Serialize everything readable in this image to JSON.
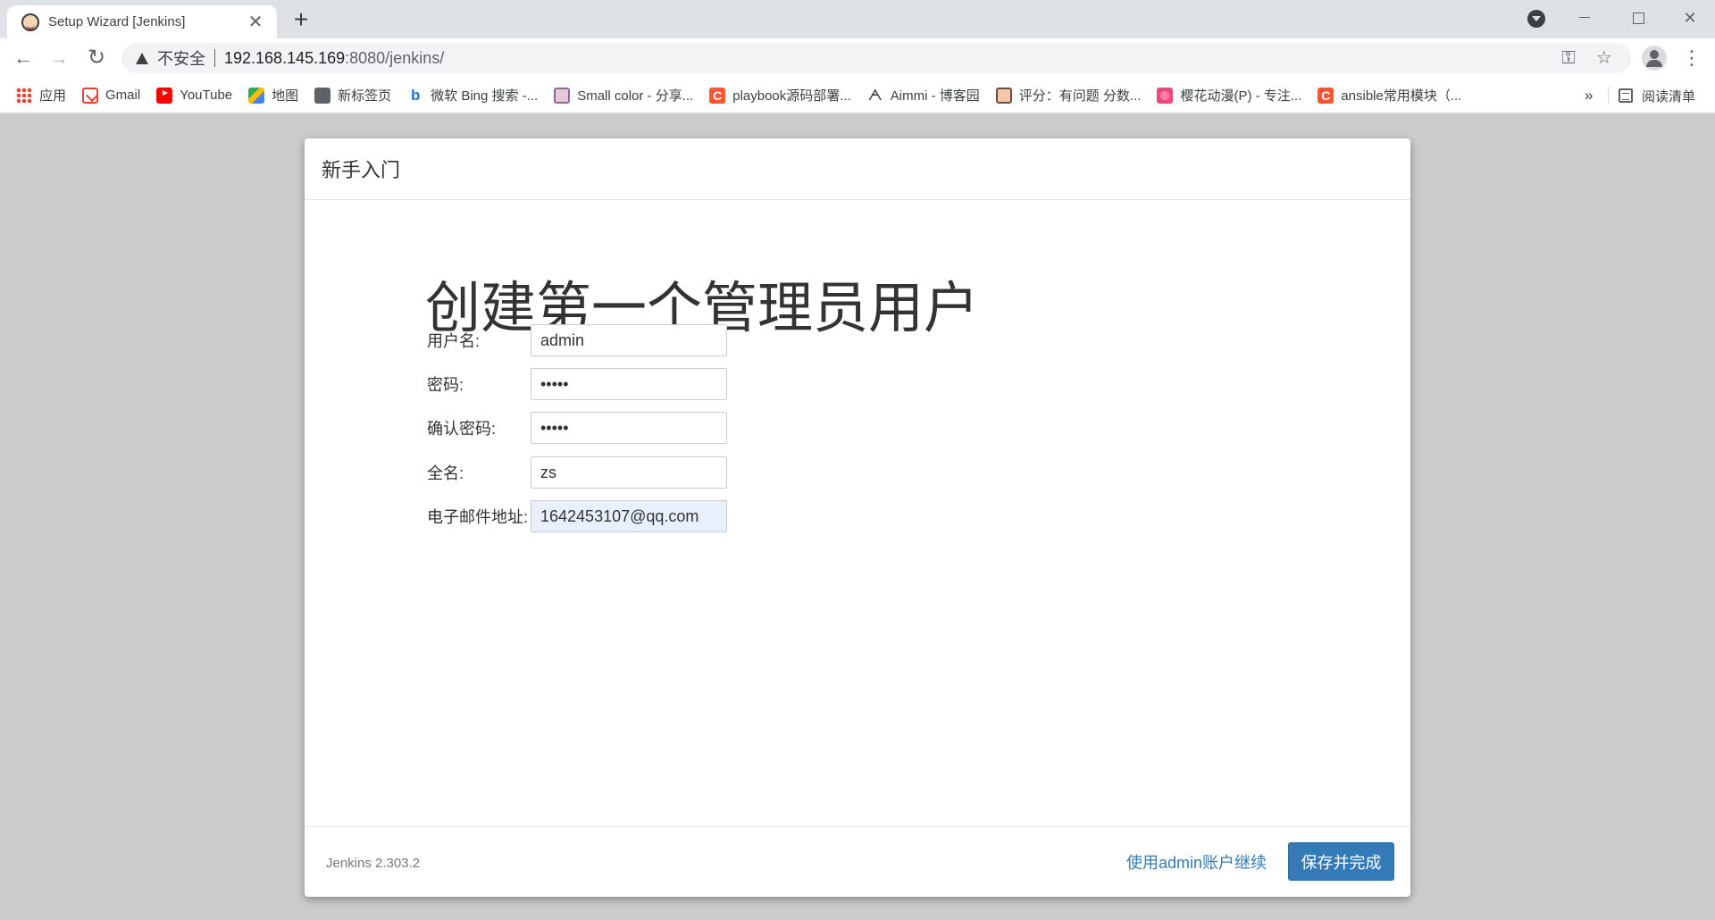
{
  "browser": {
    "tab": {
      "title": "Setup Wizard [Jenkins]",
      "close": "✕"
    },
    "new_tab": "+",
    "window_controls": {
      "close": "✕"
    },
    "nav": {
      "back": "←",
      "forward": "→",
      "reload": "↻"
    },
    "address": {
      "insecure_label": "不安全",
      "host": "192.168.145.169",
      "rest": ":8080/jenkins/"
    },
    "icons": {
      "key": "⚿",
      "star": "☆",
      "menu": "⋮"
    }
  },
  "bookmarks": {
    "items": [
      {
        "label": "应用",
        "icon": "apps-icon"
      },
      {
        "label": "Gmail",
        "icon": "gmail-icon"
      },
      {
        "label": "YouTube",
        "icon": "youtube-icon"
      },
      {
        "label": "地图",
        "icon": "maps-icon"
      },
      {
        "label": "新标签页",
        "icon": "globe-icon"
      },
      {
        "label": "微软 Bing 搜索 -...",
        "icon": "bing-icon",
        "glyph": "b"
      },
      {
        "label": "Small color - 分享...",
        "icon": "avatar-icon"
      },
      {
        "label": "playbook源码部署...",
        "icon": "csdn-icon",
        "glyph": "C"
      },
      {
        "label": "Aimmi - 博客园",
        "icon": "aimmi-icon",
        "glyph": "ᗅ"
      },
      {
        "label": "评分：有问题 分数...",
        "icon": "anime-avatar-icon"
      },
      {
        "label": "樱花动漫(P) - 专注...",
        "icon": "flower-icon"
      },
      {
        "label": "ansible常用模块（...",
        "icon": "csdn-icon",
        "glyph": "C"
      }
    ],
    "more": "»",
    "reading_list": "阅读清单"
  },
  "dialog": {
    "header_title": "新手入门",
    "heading": "创建第一个管理员用户",
    "fields": {
      "username": {
        "label": "用户名:",
        "value": "admin"
      },
      "password": {
        "label": "密码:",
        "value": "•••••"
      },
      "confirm_password": {
        "label": "确认密码:",
        "value": "•••••"
      },
      "fullname": {
        "label": "全名:",
        "value": "zs"
      },
      "email": {
        "label": "电子邮件地址:",
        "value": "1642453107@qq.com"
      }
    },
    "footer": {
      "version": "Jenkins 2.303.2",
      "continue_link": "使用admin账户继续",
      "save_button": "保存并完成"
    }
  },
  "colors": {
    "primary_button": "#337ab7",
    "link": "#337ab7",
    "page_background": "#cccccc",
    "autofill_background": "#e8f0fe"
  }
}
